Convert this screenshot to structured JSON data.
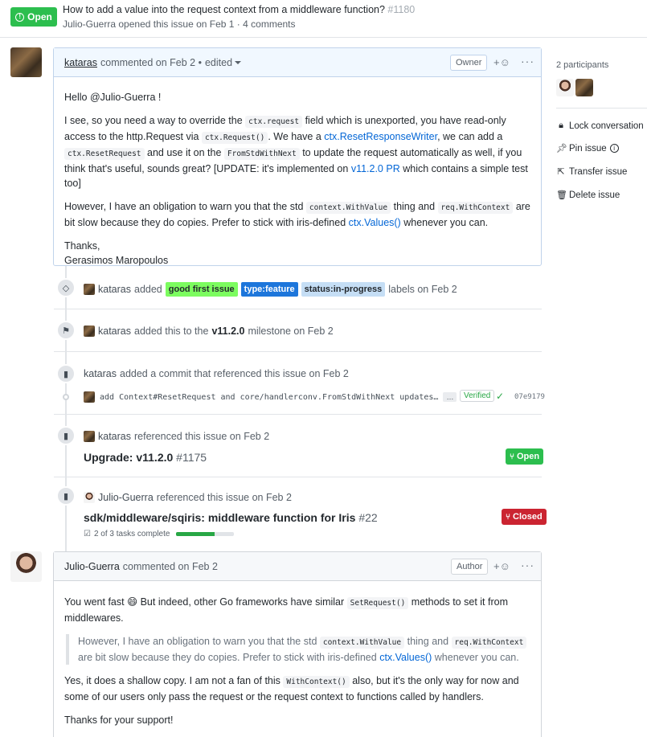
{
  "header": {
    "state_label": "Open",
    "title": "How to add a value into the request context from a middleware function?",
    "number": "#1180",
    "author": "Julio-Guerra",
    "meta_rest": "opened this issue on Feb 1 · 4 comments"
  },
  "comment1": {
    "author": "kataras",
    "action": "commented on Feb 2 •",
    "edited": "edited",
    "role": "Owner",
    "react": "+☺",
    "more": "···",
    "greeting": "Hello @Julio-Guerra !",
    "p1_a": "I see, so you need a way to override the",
    "p1_code1": "ctx.request",
    "p1_b": "field which is unexported, you have read-only access to the http.Request via",
    "p1_code2": "ctx.Request()",
    "p1_c": ". We have a",
    "p1_link1": "ctx.ResetResponseWriter",
    "p1_d": ", we can add a",
    "p1_code3": "ctx.ResetRequest",
    "p1_e": "and use it on the",
    "p1_code4": "FromStdWithNext",
    "p1_f": "to update the request automatically as well, if you think that's useful, sounds great? [UPDATE: it's implemented on",
    "p1_link2": "v11.2.0 PR",
    "p1_g": "which contains a simple test too]",
    "p2_a": "However, I have an obligation to warn you that the std",
    "p2_code1": "context.WithValue",
    "p2_b": "thing and",
    "p2_code2": "req.WithContext",
    "p2_c": "are bit slow because they do copies. Prefer to stick with iris-defined",
    "p2_link": "ctx.Values()",
    "p2_d": "whenever you can.",
    "thanks": "Thanks,",
    "signature": "Gerasimos Maropoulos"
  },
  "events": {
    "labels": {
      "who": "kataras",
      "verb": "added",
      "label1": "good first issue",
      "label1_color": "#7cfc5f",
      "label2": "type:feature",
      "label2_color": "#1d76db",
      "label3": "status:in-progress",
      "label3_color": "#c5def5",
      "tail": "labels on Feb 2"
    },
    "milestone": {
      "who": "kataras",
      "verb": "added this to the",
      "milestone": "v11.2.0",
      "tail": "milestone on Feb 2"
    },
    "commit_ref": {
      "who": "kataras",
      "text": "added a commit that referenced this issue on Feb 2",
      "commit_msg": "add Context#ResetRequest and core/handlerconv.FromStdWithNext updates…",
      "more": "…",
      "verified": "Verified",
      "check": "✓",
      "sha": "07e9179"
    },
    "ref1": {
      "who": "kataras",
      "text": "referenced this issue on Feb 2",
      "title": "Upgrade: v11.2.0",
      "number": "#1175",
      "state": "Open"
    },
    "ref2": {
      "who": "Julio-Guerra",
      "text": "referenced this issue on Feb 2",
      "title": "sdk/middleware/sqiris: middleware function for Iris",
      "number": "#22",
      "state": "Closed",
      "tasks": "2 of 3 tasks complete",
      "tasks_progress": 0.667
    }
  },
  "comment2": {
    "author": "Julio-Guerra",
    "action": "commented on Feb 2",
    "role": "Author",
    "react": "+☺",
    "more": "···",
    "p1_a": "You went fast",
    "p1_emoji": "😄",
    "p1_b": "But indeed, other Go frameworks have similar",
    "p1_code": "SetRequest()",
    "p1_c": "methods to set it from middlewares.",
    "q_a": "However, I have an obligation to warn you that the std",
    "q_code1": "context.WithValue",
    "q_b": "thing and",
    "q_code2": "req.WithContext",
    "q_c": "are bit slow because they do copies. Prefer to stick with iris-defined",
    "q_link": "ctx.Values()",
    "q_d": "whenever you can.",
    "p2_a": "Yes, it does a shallow copy. I am not a fan of this",
    "p2_code": "WithContext()",
    "p2_b": "also, but it's the only way for now and some of our users only pass the request or the request context to functions called by handlers.",
    "p3": "Thanks for your support!"
  },
  "sidebar": {
    "participants": "2 participants",
    "lock": "Lock conversation",
    "pin": "Pin issue",
    "transfer": "Transfer issue",
    "delete": "Delete issue"
  },
  "colors": {
    "open_green": "#2cbe4e",
    "closed_red": "#cb2431",
    "link_blue": "#0366d6"
  }
}
